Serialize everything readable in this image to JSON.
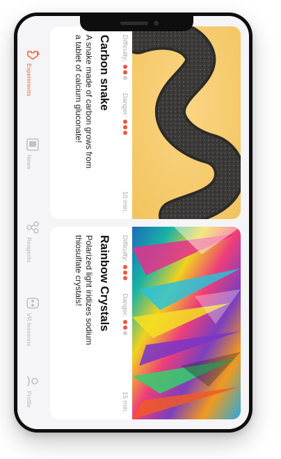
{
  "nav": {
    "items": [
      {
        "label": "Experiments",
        "icon": "flask-icon",
        "active": true
      },
      {
        "label": "News",
        "icon": "news-icon",
        "active": false
      },
      {
        "label": "Reagents",
        "icon": "molecule-icon",
        "active": false
      },
      {
        "label": "VR leassons",
        "icon": "vr-headset-icon",
        "active": false
      },
      {
        "label": "Profile",
        "icon": "profile-icon",
        "active": false
      }
    ]
  },
  "cards": [
    {
      "title": "Carbon snake",
      "description": "A snake made of carbon grows from a tablet of calcium gluconate!",
      "difficulty_label": "Difficulty:",
      "difficulty": 2,
      "danger_label": "Danger:",
      "danger": 3,
      "time": "10 min.",
      "image": "carbon-snake-photo"
    },
    {
      "title": "Rainbow Crystals",
      "description": "Polarized light iridizes sodium thiosulfate crystals!",
      "difficulty_label": "Difficulty:",
      "difficulty": 3,
      "danger_label": "Danger:",
      "danger": 2,
      "time": "15 min.",
      "image": "rainbow-crystals-photo"
    }
  ],
  "colors": {
    "accent": "#f2643f",
    "dot_on": "#f2543d",
    "dot_off": "#cfcfd3"
  }
}
